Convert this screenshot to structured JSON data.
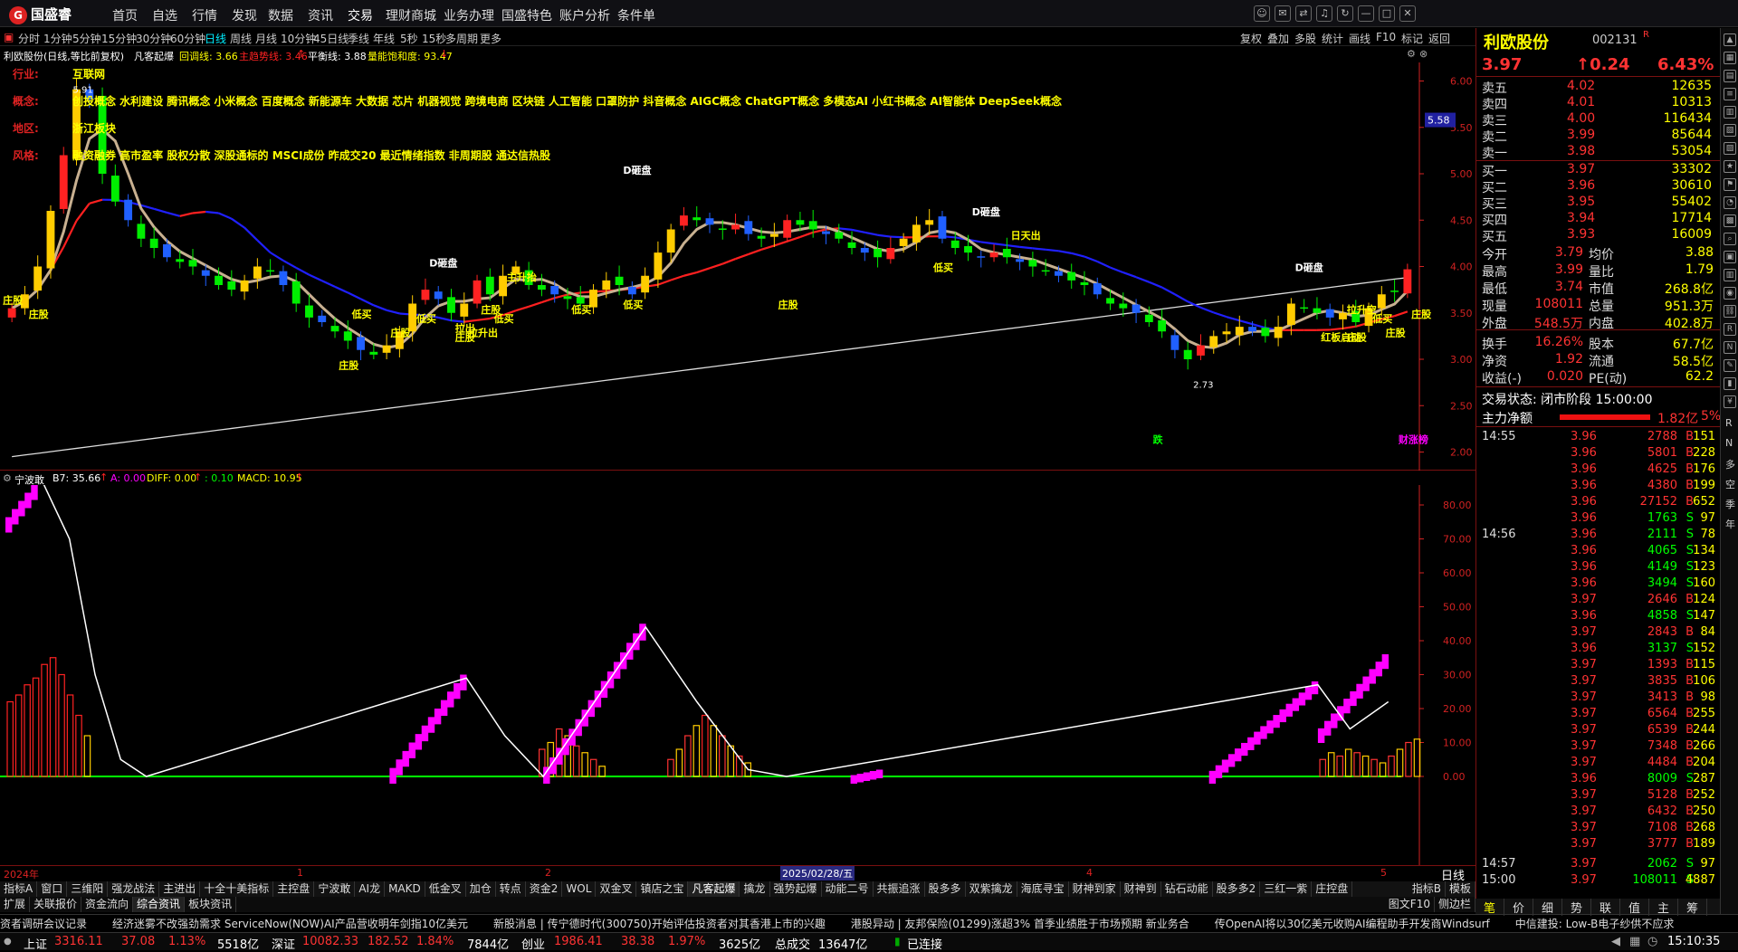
{
  "app": {
    "logo": "国盛睿"
  },
  "top_nav": [
    "首页",
    "自选",
    "行情",
    "发现",
    "数据",
    "资讯",
    "交易",
    "理财商城",
    "业务办理",
    "国盛特色",
    "账户分析",
    "条件单"
  ],
  "top_nav_active": 6,
  "window_buttons": [
    "chat-icon",
    "mail-icon",
    "shuffle-icon",
    "bell-icon",
    "refresh-icon",
    "minimize-icon",
    "maximize-icon",
    "close-icon"
  ],
  "timeframes": [
    "分时",
    "1分钟",
    "5分钟",
    "15分钟",
    "30分钟",
    "60分钟",
    "日线",
    "周线",
    "月线",
    "10分钟",
    "45日线",
    "季线",
    "年线",
    "5秒",
    "15秒",
    "多周期",
    "更多"
  ],
  "timeframe_active": 6,
  "tools": [
    "复权",
    "叠加",
    "多股",
    "统计",
    "画线",
    "F10",
    "标记",
    "返回"
  ],
  "info": {
    "name": "利欧股份(日线,等比前复权)",
    "formula": "凡客起爆",
    "callback": "回调线: 3.66",
    "trend": "主趋势线: 3.46",
    "balance": "平衡线: 3.88",
    "saturation": "量能饱和度: 93.47"
  },
  "indicator_rows": [
    {
      "label": "行业:",
      "text": "互联网"
    },
    {
      "label": "概念:",
      "text": "创投概念 水利建设 腾讯概念 小米概念 百度概念 新能源车 大数据 芯片 机器视觉 跨境电商 区块链 人工智能 口罩防护 抖音概念 AIGC概念 ChatGPT概念 多模态AI 小红书概念 AI智能体 DeepSeek概念"
    },
    {
      "label": "地区:",
      "text": "浙江板块"
    },
    {
      "label": "风格:",
      "text": "融资融券 高市盈率 股权分散 深股通标的 MSCI成份 昨成交20 最近情绪指数 非周期股 通达信热股"
    }
  ],
  "price_axis": [
    "6.00",
    "5.50",
    "5.00",
    "4.50",
    "4.00",
    "3.50",
    "3.00",
    "2.50",
    "2.00"
  ],
  "price_tag": "5.58",
  "signals": [
    "庄股",
    "庄股",
    "庄股",
    "庄股",
    "庄股",
    "庄股",
    "庄股",
    "庄股",
    "庄股",
    "庄股",
    "低买",
    "低买",
    "低买",
    "低买",
    "低买",
    "低买",
    "低买",
    "D砸盘",
    "D砸盘",
    "D砸盘",
    "D砸盘",
    "拉升出",
    "主升抬",
    "拉出",
    "日天出",
    "红板启动",
    "拉升空",
    "跌",
    "财涨榜"
  ],
  "peaks": {
    "high": "5.91",
    "low": "2.73"
  },
  "sub_header": {
    "name": "宁波敢",
    "b7": "B7: 35.66",
    "a": "A: 0.00",
    "diff": "DIFF: 0.00",
    "dea": ": 0.10",
    "macd": "MACD: 10.95"
  },
  "sub_axis": [
    "80.00",
    "70.00",
    "60.00",
    "50.00",
    "40.00",
    "30.00",
    "20.00",
    "10.00",
    "0.00"
  ],
  "x_labels": {
    "y2024": "2024年",
    "m1": "1",
    "m2": "2",
    "date": "2025/02/28/五",
    "m4": "4",
    "m5": "5"
  },
  "tabs_row1": [
    "指标A",
    "窗口",
    "三维阳",
    "强龙战法",
    "主进出",
    "十全十美指标",
    "主控盘",
    "宁波敢",
    "AI龙",
    "MAKD",
    "低金叉",
    "加仓",
    "转点",
    "资金2",
    "WOL",
    "双金叉",
    "镇店之宝",
    "凡客起爆",
    "擒龙",
    "强势起爆",
    "动能二号",
    "共振追涨",
    "股多多",
    "双紫擒龙",
    "海底寻宝",
    "财神到家",
    "财神到",
    "钻石动能",
    "股多多2",
    "三红一紫",
    "庄控盘"
  ],
  "tabs_row1_active": 17,
  "tabs_row1_right": [
    "指标B",
    "模板"
  ],
  "tabs_row2": [
    "扩展",
    "关联报价",
    "资金流向",
    "综合资讯",
    "板块资讯"
  ],
  "tabs_row2_right": [
    "图文F10",
    "侧边栏"
  ],
  "news": [
    "资者调研会议记录",
    "经济迷雾不改强劲需求 ServiceNow(NOW)AI产品营收明年剑指10亿美元",
    "新股消息 | 传宁德时代(300750)开始评估投资者对其香港上市的兴趣",
    "港股异动 | 友邦保险(01299)涨超3% 首季业绩胜于市场预期 新业务合",
    "传OpenAI将以30亿美元收购AI编程助手开发商Windsurf",
    "中信建投: Low-B电子纱供不应求"
  ],
  "status": {
    "sh_name": "上证",
    "sh_val": "3316.11",
    "sh_chg": "37.08",
    "sh_pct": "1.13%",
    "sh_amt": "5518亿",
    "sz_name": "深证",
    "sz_val": "10082.33",
    "sz_chg": "182.52",
    "sz_pct": "1.84%",
    "sz_amt": "7844亿",
    "cy_name": "创业",
    "cy_val": "1986.41",
    "cy_chg": "38.38",
    "cy_pct": "1.97%",
    "cy_amt": "3625亿",
    "total_name": "总成交",
    "total": "13647亿",
    "conn": "已连接",
    "time": "15:10:35"
  },
  "quote": {
    "name": "利欧股份",
    "code": "002131",
    "price": "3.97",
    "chg": "↑0.24",
    "pct": "6.43%"
  },
  "orderbook": [
    {
      "l": "卖五",
      "p": "4.02",
      "v": "12635"
    },
    {
      "l": "卖四",
      "p": "4.01",
      "v": "10313"
    },
    {
      "l": "卖三",
      "p": "4.00",
      "v": "116434"
    },
    {
      "l": "卖二",
      "p": "3.99",
      "v": "85644"
    },
    {
      "l": "卖一",
      "p": "3.98",
      "v": "53054"
    },
    {
      "l": "买一",
      "p": "3.97",
      "v": "33302"
    },
    {
      "l": "买二",
      "p": "3.96",
      "v": "30610"
    },
    {
      "l": "买三",
      "p": "3.95",
      "v": "55402"
    },
    {
      "l": "买四",
      "p": "3.94",
      "v": "17714"
    },
    {
      "l": "买五",
      "p": "3.93",
      "v": "16009"
    }
  ],
  "stats": [
    {
      "a": "今开",
      "b": "3.79",
      "c": "均价",
      "d": "3.88"
    },
    {
      "a": "最高",
      "b": "3.99",
      "c": "量比",
      "d": "1.79"
    },
    {
      "a": "最低",
      "b": "3.74",
      "c": "市值",
      "d": "268.8亿"
    },
    {
      "a": "现量",
      "b": "108011",
      "c": "总量",
      "d": "951.3万"
    },
    {
      "a": "外盘",
      "b": "548.5万",
      "c": "内盘",
      "d": "402.8万"
    },
    {
      "a": "换手",
      "b": "16.26%",
      "c": "股本",
      "d": "67.7亿"
    },
    {
      "a": "净资",
      "b": "1.92",
      "c": "流通",
      "d": "58.5亿"
    },
    {
      "a": "收益(-)",
      "b": "0.020",
      "c": "PE(动)",
      "d": "62.2"
    }
  ],
  "trade_state": "交易状态: 闭市阶段 15:00:00",
  "main_net": {
    "label": "主力净额",
    "value": "1.82亿",
    "pct": "5%"
  },
  "ticks": [
    {
      "t": "14:55",
      "p": "3.96",
      "v": "2788",
      "f": "B",
      "n": "151"
    },
    {
      "t": "",
      "p": "3.96",
      "v": "5801",
      "f": "B",
      "n": "228"
    },
    {
      "t": "",
      "p": "3.96",
      "v": "4625",
      "f": "B",
      "n": "176"
    },
    {
      "t": "",
      "p": "3.96",
      "v": "4380",
      "f": "B",
      "n": "199"
    },
    {
      "t": "",
      "p": "3.96",
      "v": "27152",
      "f": "B",
      "n": "652"
    },
    {
      "t": "",
      "p": "3.96",
      "v": "1763",
      "f": "S",
      "n": "97"
    },
    {
      "t": "14:56",
      "p": "3.96",
      "v": "2111",
      "f": "S",
      "n": "78"
    },
    {
      "t": "",
      "p": "3.96",
      "v": "4065",
      "f": "S",
      "n": "134"
    },
    {
      "t": "",
      "p": "3.96",
      "v": "4149",
      "f": "S",
      "n": "123"
    },
    {
      "t": "",
      "p": "3.96",
      "v": "3494",
      "f": "S",
      "n": "160"
    },
    {
      "t": "",
      "p": "3.97",
      "v": "2646",
      "f": "B",
      "n": "124"
    },
    {
      "t": "",
      "p": "3.96",
      "v": "4858",
      "f": "S",
      "n": "147"
    },
    {
      "t": "",
      "p": "3.97",
      "v": "2843",
      "f": "B",
      "n": "84"
    },
    {
      "t": "",
      "p": "3.96",
      "v": "3137",
      "f": "S",
      "n": "152"
    },
    {
      "t": "",
      "p": "3.97",
      "v": "1393",
      "f": "B",
      "n": "115"
    },
    {
      "t": "",
      "p": "3.97",
      "v": "3835",
      "f": "B",
      "n": "106"
    },
    {
      "t": "",
      "p": "3.97",
      "v": "3413",
      "f": "B",
      "n": "98"
    },
    {
      "t": "",
      "p": "3.97",
      "v": "6564",
      "f": "B",
      "n": "255"
    },
    {
      "t": "",
      "p": "3.97",
      "v": "6539",
      "f": "B",
      "n": "244"
    },
    {
      "t": "",
      "p": "3.97",
      "v": "7348",
      "f": "B",
      "n": "266"
    },
    {
      "t": "",
      "p": "3.97",
      "v": "4484",
      "f": "B",
      "n": "204"
    },
    {
      "t": "",
      "p": "3.96",
      "v": "8009",
      "f": "S",
      "n": "287"
    },
    {
      "t": "",
      "p": "3.97",
      "v": "5128",
      "f": "B",
      "n": "252"
    },
    {
      "t": "",
      "p": "3.97",
      "v": "6432",
      "f": "B",
      "n": "250"
    },
    {
      "t": "",
      "p": "3.97",
      "v": "7108",
      "f": "B",
      "n": "268"
    },
    {
      "t": "",
      "p": "3.97",
      "v": "3777",
      "f": "B",
      "n": "189"
    },
    {
      "t": "14:57",
      "p": "3.97",
      "v": "2062",
      "f": "S",
      "n": "97"
    },
    {
      "t": "15:00",
      "p": "3.97",
      "v": "108011",
      "f": "S",
      "n": "4887"
    }
  ],
  "right_tabs": [
    "笔",
    "价",
    "细",
    "势",
    "联",
    "值",
    "主",
    "筹"
  ],
  "right_tabs_active": 0,
  "sidebar_icons": [
    "up-icon",
    "grid-icon",
    "doc-icon",
    "list-icon",
    "chart-icon",
    "table-icon",
    "calendar-icon",
    "star-icon",
    "flag-icon",
    "pie-icon",
    "layers-icon",
    "search-icon",
    "cube-icon",
    "book-icon",
    "pin-icon",
    "link-icon",
    "rss-icon",
    "news-icon",
    "pen-icon",
    "bars-icon",
    "money-icon"
  ],
  "sidebar_text": [
    "R",
    "N",
    "多",
    "空",
    "季",
    "年"
  ],
  "colors": {
    "up": "#ff3333",
    "down": "#00ff00",
    "yellow": "#ffff00",
    "magenta": "#ff00ff",
    "ma_blue": "#2020ff",
    "ma_red": "#ff2020",
    "ma_tan": "#c8b090",
    "ma_white": "#dddddd",
    "axis_red": "#d22222"
  },
  "chart_data": [
    {
      "type": "candlestick",
      "title": "利欧股份(日线,等比前复权)",
      "y_axis": {
        "min": 1.8,
        "max": 6.2,
        "ticks": [
          6.0,
          5.5,
          5.0,
          4.5,
          4.0,
          3.5,
          3.0,
          2.5,
          2.0
        ]
      },
      "close": [
        3.55,
        3.7,
        4.0,
        4.6,
        5.2,
        5.91,
        5.8,
        5.0,
        4.7,
        4.5,
        4.3,
        4.2,
        4.1,
        4.05,
        4.0,
        3.9,
        3.8,
        3.75,
        3.85,
        4.0,
        3.95,
        3.8,
        3.6,
        3.45,
        3.4,
        3.3,
        3.2,
        3.1,
        3.05,
        3.15,
        3.3,
        3.6,
        3.75,
        3.65,
        3.5,
        3.6,
        3.85,
        3.7,
        3.9,
        4.0,
        3.8,
        3.75,
        3.7,
        3.65,
        3.6,
        3.75,
        3.85,
        3.8,
        3.7,
        3.9,
        4.15,
        4.4,
        4.55,
        4.5,
        4.45,
        4.4,
        4.45,
        4.35,
        4.3,
        4.35,
        4.5,
        4.45,
        4.4,
        4.35,
        4.3,
        4.2,
        4.15,
        4.1,
        4.2,
        4.3,
        4.45,
        4.5,
        4.3,
        4.2,
        4.15,
        4.1,
        4.15,
        4.1,
        4.05,
        4.0,
        3.95,
        3.9,
        3.85,
        3.8,
        3.7,
        3.6,
        3.55,
        3.5,
        3.4,
        3.3,
        3.1,
        3.0,
        3.15,
        3.25,
        3.3,
        3.35,
        3.3,
        3.25,
        3.35,
        3.6,
        3.55,
        3.5,
        3.45,
        3.5,
        3.4,
        3.55,
        3.7,
        3.73,
        3.97
      ],
      "annotations": {
        "high": 5.91,
        "low": 2.73
      }
    },
    {
      "type": "bar",
      "title": "宁波敢",
      "y_axis": {
        "min": 0,
        "max": 80,
        "ticks": [
          80,
          70,
          60,
          50,
          40,
          30,
          20,
          10,
          0
        ]
      },
      "bars": [
        [
          0,
          22
        ],
        [
          1,
          24
        ],
        [
          2,
          27
        ],
        [
          3,
          29
        ],
        [
          4,
          33
        ],
        [
          5,
          35
        ],
        [
          6,
          30
        ],
        [
          7,
          24
        ],
        [
          8,
          18
        ],
        [
          9,
          12
        ],
        [
          62,
          8
        ],
        [
          63,
          10
        ],
        [
          64,
          14
        ],
        [
          65,
          12
        ],
        [
          66,
          9
        ],
        [
          67,
          7
        ],
        [
          68,
          5
        ],
        [
          69,
          3
        ],
        [
          77,
          5
        ],
        [
          78,
          8
        ],
        [
          79,
          12
        ],
        [
          80,
          15
        ],
        [
          81,
          18
        ],
        [
          82,
          15
        ],
        [
          83,
          12
        ],
        [
          84,
          9
        ],
        [
          85,
          6
        ],
        [
          86,
          4
        ],
        [
          153,
          5
        ],
        [
          154,
          7
        ],
        [
          155,
          6
        ],
        [
          156,
          8
        ],
        [
          157,
          7
        ],
        [
          158,
          6
        ],
        [
          159,
          5
        ],
        [
          160,
          4
        ],
        [
          161,
          6
        ],
        [
          162,
          8
        ],
        [
          163,
          10
        ],
        [
          164,
          11
        ]
      ],
      "magenta_spans": [
        [
          0,
          5,
          74,
          86
        ],
        [
          60,
          72,
          0,
          30
        ],
        [
          84,
          100,
          0,
          45
        ],
        [
          132,
          137,
          0,
          2
        ],
        [
          188,
          205,
          0,
          28
        ],
        [
          205,
          216,
          12,
          36
        ]
      ],
      "white_line": [
        [
          6,
          86
        ],
        [
          10,
          70
        ],
        [
          14,
          30
        ],
        [
          18,
          5
        ],
        [
          22,
          0
        ],
        [
          72,
          29
        ],
        [
          78,
          12
        ],
        [
          84,
          0
        ],
        [
          100,
          44
        ],
        [
          108,
          22
        ],
        [
          116,
          2
        ],
        [
          122,
          0
        ],
        [
          205,
          27
        ],
        [
          210,
          14
        ],
        [
          216,
          22
        ]
      ]
    }
  ]
}
